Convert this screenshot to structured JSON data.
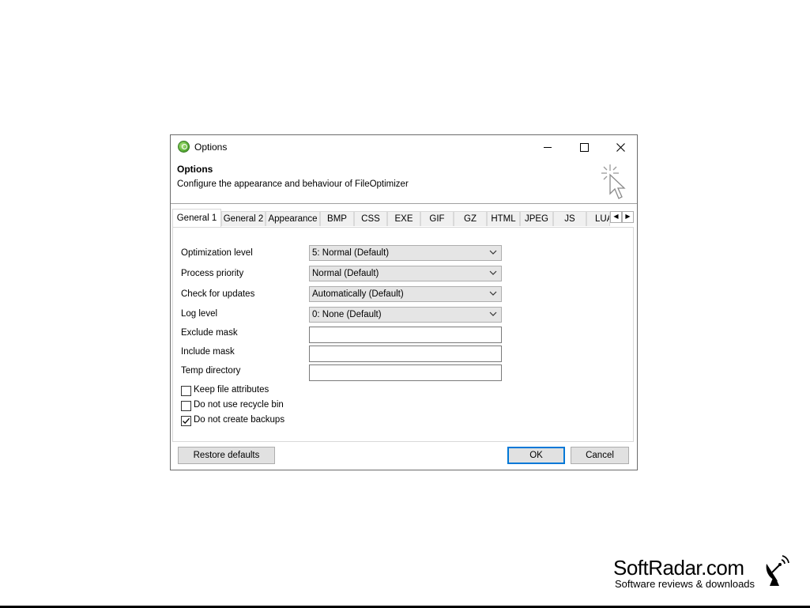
{
  "window": {
    "title": "Options",
    "controls": {
      "minimize": "minimize",
      "maximize": "maximize",
      "close": "close"
    }
  },
  "header": {
    "title": "Options",
    "description": "Configure the appearance and behaviour of FileOptimizer"
  },
  "tabs": [
    {
      "label": "General 1",
      "active": true
    },
    {
      "label": "General 2"
    },
    {
      "label": "Appearance"
    },
    {
      "label": "BMP"
    },
    {
      "label": "CSS"
    },
    {
      "label": "EXE"
    },
    {
      "label": "GIF"
    },
    {
      "label": "GZ"
    },
    {
      "label": "HTML"
    },
    {
      "label": "JPEG"
    },
    {
      "label": "JS"
    },
    {
      "label": "LUA"
    }
  ],
  "settings": {
    "optimization_level": {
      "label": "Optimization level",
      "value": "5: Normal (Default)"
    },
    "process_priority": {
      "label": "Process priority",
      "value": "Normal (Default)"
    },
    "check_updates": {
      "label": "Check for updates",
      "value": "Automatically (Default)"
    },
    "log_level": {
      "label": "Log level",
      "value": "0: None (Default)"
    },
    "exclude_mask": {
      "label": "Exclude mask",
      "value": ""
    },
    "include_mask": {
      "label": "Include mask",
      "value": ""
    },
    "temp_directory": {
      "label": "Temp directory",
      "value": ""
    }
  },
  "checkboxes": [
    {
      "label": "Keep file attributes",
      "checked": false
    },
    {
      "label": "Do not use recycle bin",
      "checked": false
    },
    {
      "label": "Do not create backups",
      "checked": true
    }
  ],
  "buttons": {
    "restore": "Restore defaults",
    "ok": "OK",
    "cancel": "Cancel"
  },
  "watermark": {
    "brand": "SoftRadar.com",
    "tagline": "Software reviews & downloads"
  },
  "colors": {
    "focus_blue": "#0078d7",
    "combo_bg": "#e5e5e5",
    "button_bg": "#e1e1e1"
  }
}
